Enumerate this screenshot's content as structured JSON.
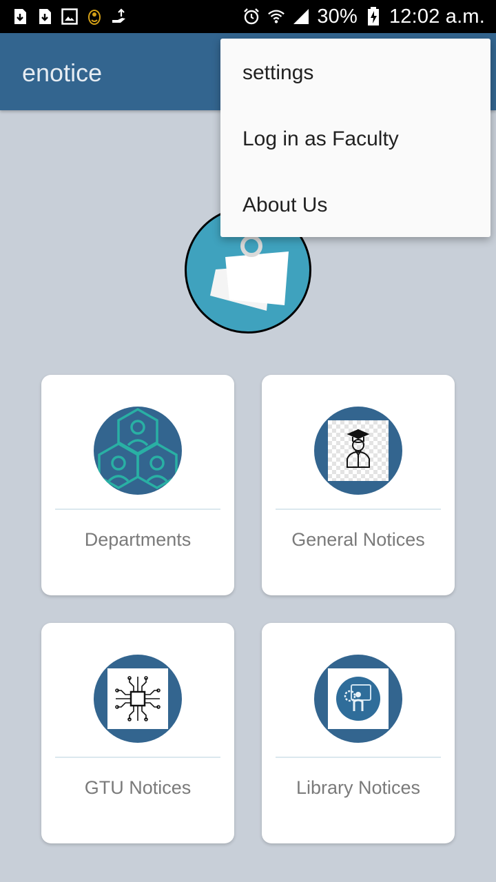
{
  "status_bar": {
    "left_icons": [
      "sd-card-download-icon",
      "sd-card-download-icon",
      "image-icon",
      "ganesha-icon",
      "hand-upload-icon"
    ],
    "right_icons": [
      "alarm-icon",
      "wifi-icon",
      "signal-icon",
      "battery-charging-icon"
    ],
    "battery": "30%",
    "time": "12:02 a.m."
  },
  "app_bar": {
    "title": "enotice"
  },
  "logo": {
    "icon": "sticky-notes-icon"
  },
  "cards": [
    {
      "label": "Departments",
      "icon": "people-hexagon-icon"
    },
    {
      "label": "General Notices",
      "icon": "graduate-icon"
    },
    {
      "label": "GTU Notices",
      "icon": "circuit-chip-icon"
    },
    {
      "label": "Library Notices",
      "icon": "person-gear-board-icon"
    }
  ],
  "overflow_menu": {
    "items": [
      {
        "label": "settings"
      },
      {
        "label": "Log in as Faculty"
      },
      {
        "label": "About Us"
      }
    ]
  },
  "colors": {
    "app_bar": "#33658f",
    "background": "#c8cfd8",
    "logo_fill": "#3fa2be",
    "card_circle": "#33658f"
  }
}
